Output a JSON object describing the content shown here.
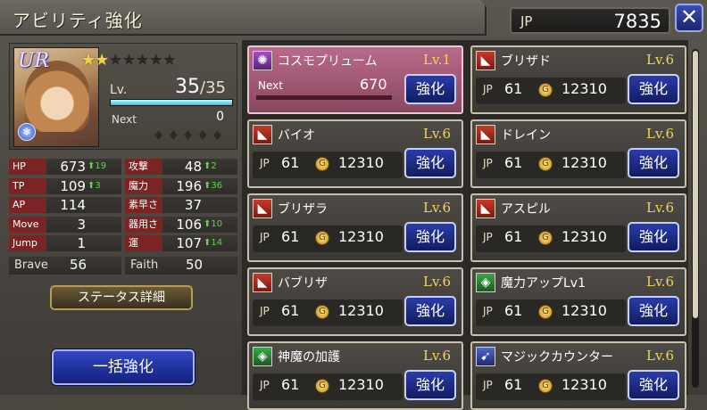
{
  "header": {
    "title": "アビリティ強化",
    "jp_label": "JP",
    "jp_value": "7835",
    "close_label": "✕"
  },
  "unit": {
    "rank": "UR",
    "stars_filled": 2,
    "stars_total": 7,
    "level_label": "Lv.",
    "level": "35",
    "level_max": "/35",
    "level_progress": 1.0,
    "next_label": "Next",
    "next_value": "0",
    "element_icon": "ice-element-icon"
  },
  "stats": [
    {
      "left": {
        "label": "HP",
        "value": "673",
        "bonus": "⬆19"
      },
      "right": {
        "label": "攻撃",
        "value": "48",
        "bonus": "⬆2"
      }
    },
    {
      "left": {
        "label": "TP",
        "value": "109",
        "bonus": "⬆3"
      },
      "right": {
        "label": "魔力",
        "value": "196",
        "bonus": "⬆36"
      }
    },
    {
      "left": {
        "label": "AP",
        "value": "114",
        "bonus": ""
      },
      "right": {
        "label": "素早さ",
        "value": "37",
        "bonus": ""
      }
    },
    {
      "left": {
        "label": "Move",
        "value": "3",
        "bonus": ""
      },
      "right": {
        "label": "器用さ",
        "value": "106",
        "bonus": "⬆10"
      }
    },
    {
      "left": {
        "label": "Jump",
        "value": "1",
        "bonus": ""
      },
      "right": {
        "label": "運",
        "value": "107",
        "bonus": "⬆14"
      }
    }
  ],
  "brave": {
    "label": "Brave",
    "value": "56"
  },
  "faith": {
    "label": "Faith",
    "value": "50"
  },
  "buttons": {
    "status_detail": "ステータス詳細",
    "bulk_enhance": "一括強化"
  },
  "abilities": [
    {
      "name": "コスモプリューム",
      "level": "Lv.1",
      "icon": "cosmo-icon",
      "selected": true,
      "next_label": "Next",
      "next_value": "670",
      "button": "強化"
    },
    {
      "name": "ブリザド",
      "level": "Lv.6",
      "icon": "black-magic-icon",
      "jp_label": "JP",
      "jp_cost": "61",
      "gil": "12310",
      "button": "強化"
    },
    {
      "name": "バイオ",
      "level": "Lv.6",
      "icon": "black-magic-icon",
      "jp_label": "JP",
      "jp_cost": "61",
      "gil": "12310",
      "button": "強化"
    },
    {
      "name": "ドレイン",
      "level": "Lv.6",
      "icon": "black-magic-icon",
      "jp_label": "JP",
      "jp_cost": "61",
      "gil": "12310",
      "button": "強化"
    },
    {
      "name": "ブリザラ",
      "level": "Lv.6",
      "icon": "black-magic-icon",
      "jp_label": "JP",
      "jp_cost": "61",
      "gil": "12310",
      "button": "強化"
    },
    {
      "name": "アスピル",
      "level": "Lv.6",
      "icon": "black-magic-icon",
      "jp_label": "JP",
      "jp_cost": "61",
      "gil": "12310",
      "button": "強化"
    },
    {
      "name": "バブリザ",
      "level": "Lv.6",
      "icon": "black-magic-icon",
      "jp_label": "JP",
      "jp_cost": "61",
      "gil": "12310",
      "button": "強化"
    },
    {
      "name": "魔力アップLv1",
      "level": "Lv.6",
      "icon": "support-icon",
      "jp_label": "JP",
      "jp_cost": "61",
      "gil": "12310",
      "button": "強化"
    },
    {
      "name": "神魔の加護",
      "level": "Lv.6",
      "icon": "support-icon",
      "jp_label": "JP",
      "jp_cost": "61",
      "gil": "12310",
      "button": "強化"
    },
    {
      "name": "マジックカウンター",
      "level": "Lv.6",
      "icon": "reaction-icon",
      "jp_label": "JP",
      "jp_cost": "61",
      "gil": "12310",
      "button": "強化"
    }
  ]
}
